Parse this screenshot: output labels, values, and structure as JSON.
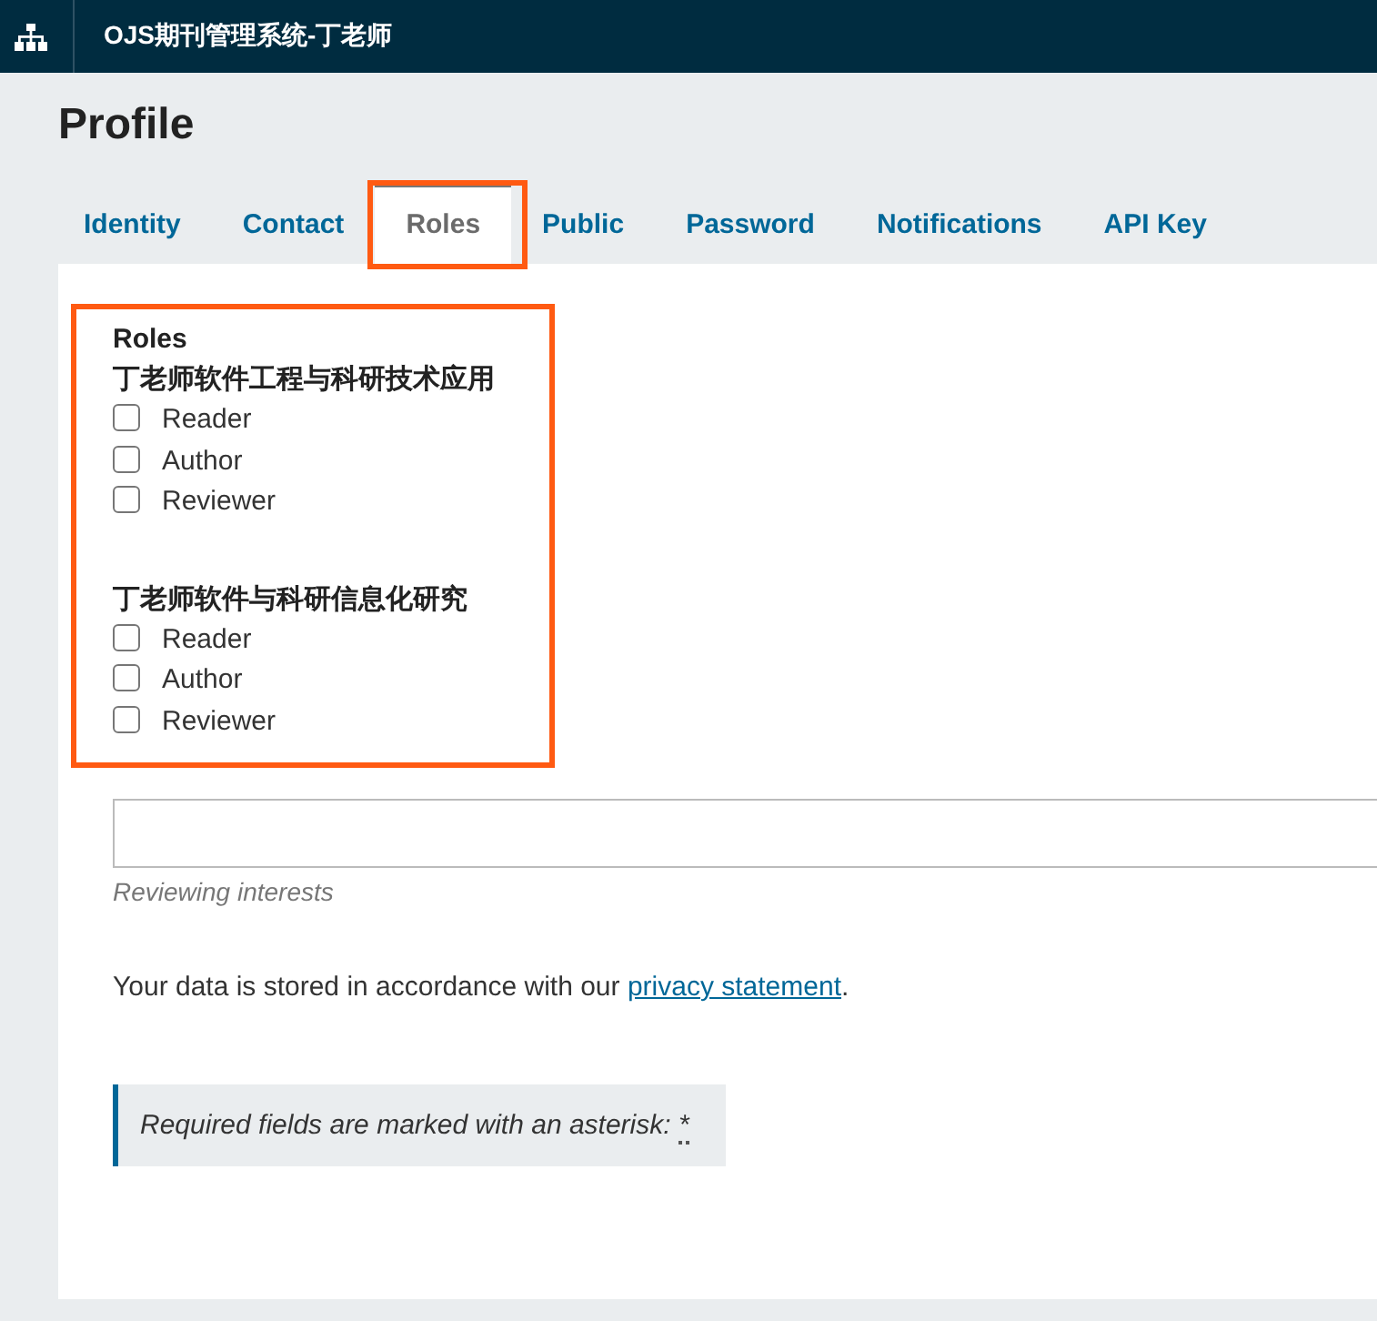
{
  "header": {
    "title": "OJS期刊管理系统-丁老师"
  },
  "page": {
    "title": "Profile"
  },
  "tabs": [
    {
      "label": "Identity",
      "selected": false,
      "highlighted": false
    },
    {
      "label": "Contact",
      "selected": false,
      "highlighted": false
    },
    {
      "label": "Roles",
      "selected": true,
      "highlighted": true
    },
    {
      "label": "Public",
      "selected": false,
      "highlighted": false
    },
    {
      "label": "Password",
      "selected": false,
      "highlighted": false
    },
    {
      "label": "Notifications",
      "selected": false,
      "highlighted": false
    },
    {
      "label": "API Key",
      "selected": false,
      "highlighted": false
    }
  ],
  "roles": {
    "legend": "Roles",
    "highlighted": true,
    "groups": [
      {
        "title": "丁老师软件工程与科研技术应用",
        "options": [
          {
            "label": "Reader",
            "checked": false
          },
          {
            "label": "Author",
            "checked": false
          },
          {
            "label": "Reviewer",
            "checked": false
          }
        ]
      },
      {
        "title": "丁老师软件与科研信息化研究",
        "options": [
          {
            "label": "Reader",
            "checked": false
          },
          {
            "label": "Author",
            "checked": false
          },
          {
            "label": "Reviewer",
            "checked": false
          }
        ]
      }
    ]
  },
  "interests": {
    "label": "Reviewing interests"
  },
  "privacy": {
    "text_before": "Your data is stored in accordance with our",
    "link": "privacy statement",
    "text_after": "."
  },
  "notice": {
    "text": "Required fields are marked with an asterisk:",
    "marker": "*"
  }
}
